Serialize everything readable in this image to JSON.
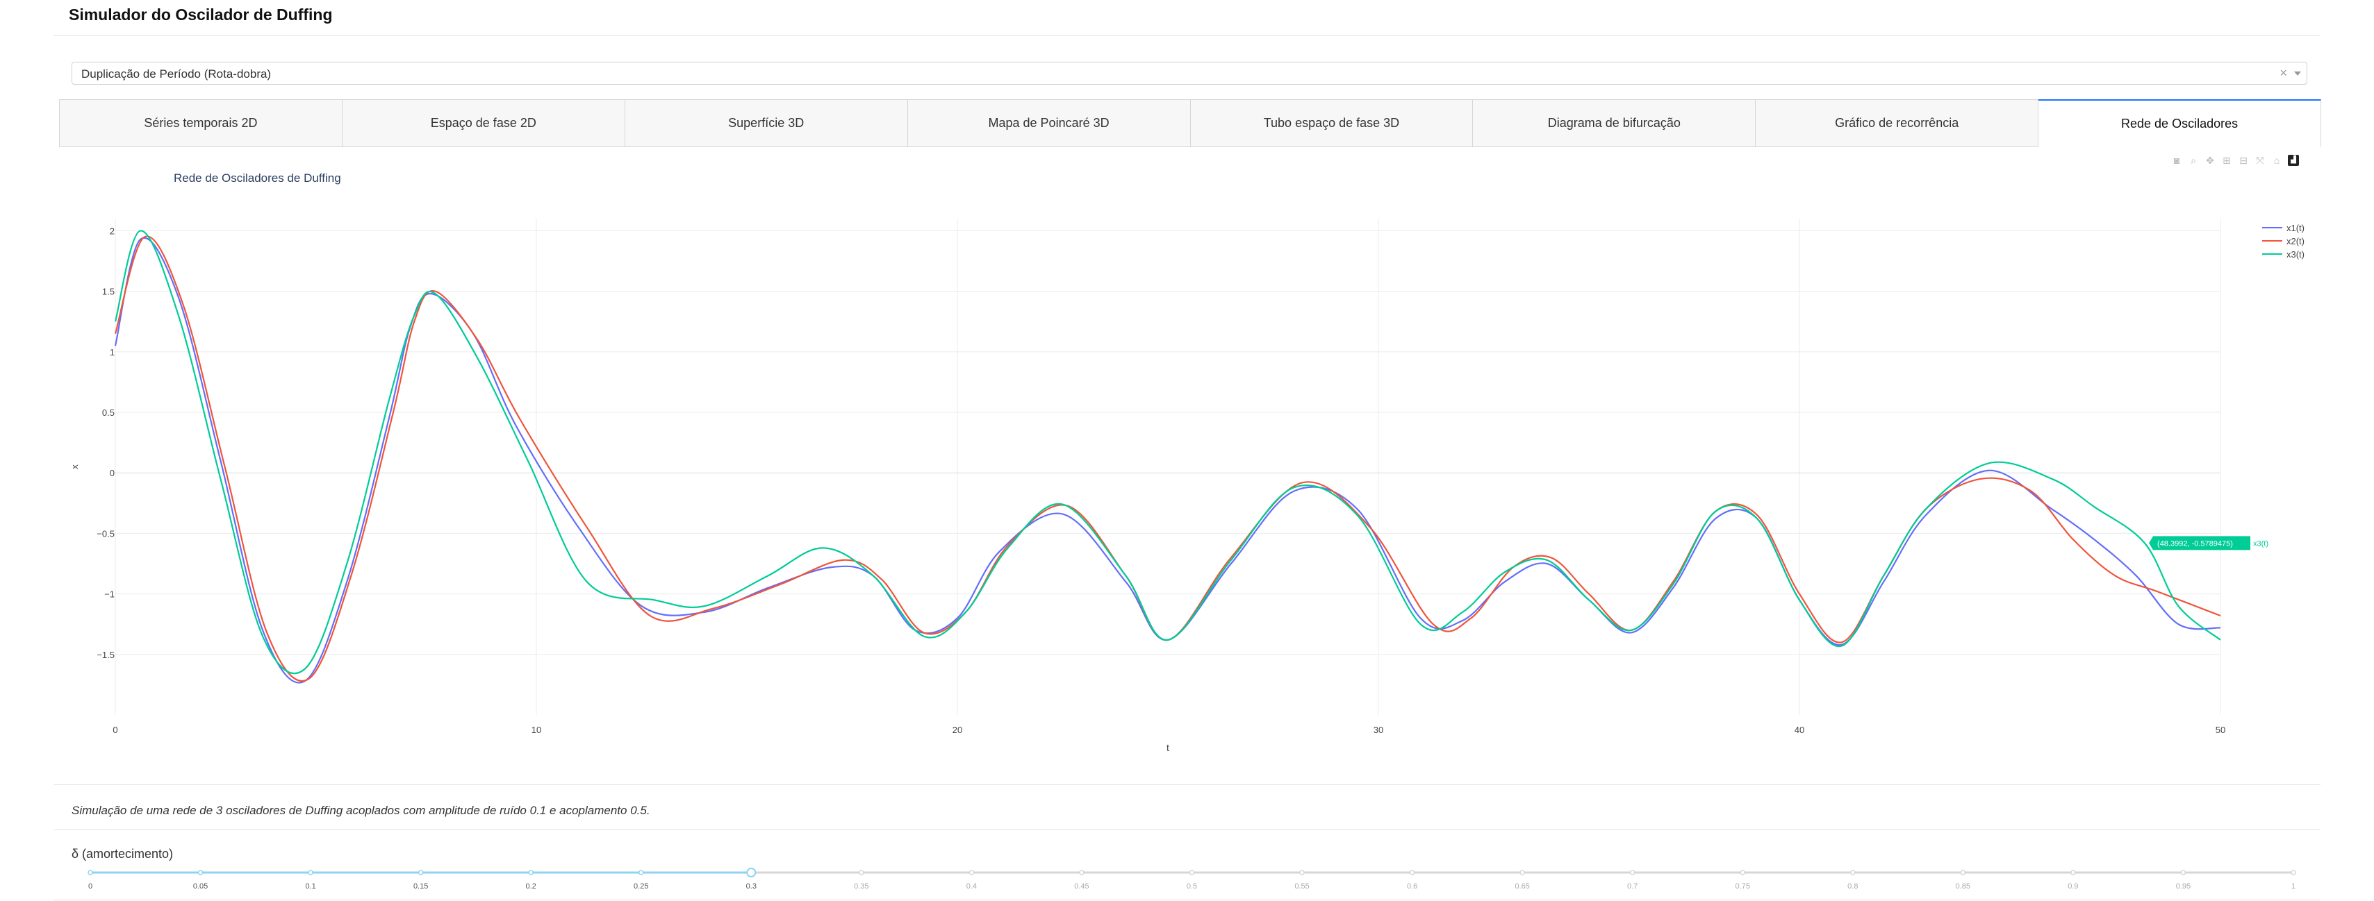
{
  "app": {
    "title": "Simulador do Oscilador de Duffing"
  },
  "preset": {
    "selected": "Duplicação de Período (Rota-dobra)",
    "clear": "×"
  },
  "tabs": [
    {
      "label": "Séries temporais 2D"
    },
    {
      "label": "Espaço de fase 2D"
    },
    {
      "label": "Superfície 3D"
    },
    {
      "label": "Mapa de Poincaré 3D"
    },
    {
      "label": "Tubo espaço de fase 3D"
    },
    {
      "label": "Diagrama de bifurcação"
    },
    {
      "label": "Gráfico de recorrência"
    },
    {
      "label": "Rede de Osciladores",
      "active": true
    }
  ],
  "modebar": [
    "camera-icon",
    "zoom-icon",
    "pan-icon",
    "zoom-in-icon",
    "zoom-out-icon",
    "autoscale-icon",
    "home-icon",
    "plotly-logo-icon"
  ],
  "chart_data": {
    "type": "line",
    "title": "Rede de Osciladores de Duffing",
    "xlabel": "t",
    "ylabel": "x",
    "xlim": [
      0,
      50
    ],
    "ylim": [
      -2,
      2.1
    ],
    "xticks": [
      0,
      10,
      20,
      30,
      40,
      50
    ],
    "yticks": [
      -1.5,
      -1,
      -0.5,
      0,
      0.5,
      1,
      1.5,
      2
    ],
    "ytick_labels": [
      "−1.5",
      "−1",
      "−0.5",
      "0",
      "0.5",
      "1",
      "1.5",
      "2"
    ],
    "grid": true,
    "legend_position": "top-right",
    "series": [
      {
        "name": "x1(t)",
        "color": "#636efa",
        "x": [
          0,
          0.6,
          1.5,
          2.5,
          3.5,
          4.5,
          5.5,
          6.5,
          7,
          7.5,
          8.5,
          9.5,
          11,
          12.5,
          14,
          15.5,
          17,
          18,
          19,
          20,
          21,
          22.5,
          24,
          25,
          26.5,
          28,
          29.5,
          31,
          32,
          33,
          34,
          35,
          36,
          37,
          38,
          39,
          40,
          41,
          42,
          43,
          44.5,
          46,
          47,
          48,
          49,
          50
        ],
        "y": [
          1.05,
          1.93,
          1.45,
          0.1,
          -1.3,
          -1.72,
          -0.9,
          0.45,
          1.2,
          1.48,
          1.15,
          0.4,
          -0.45,
          -1.1,
          -1.15,
          -0.95,
          -0.78,
          -0.85,
          -1.3,
          -1.2,
          -0.65,
          -0.34,
          -0.9,
          -1.38,
          -0.75,
          -0.15,
          -0.3,
          -1.2,
          -1.22,
          -0.9,
          -0.75,
          -1.05,
          -1.32,
          -0.95,
          -0.38,
          -0.38,
          -1.05,
          -1.42,
          -0.9,
          -0.35,
          0.02,
          -0.3,
          -0.55,
          -0.85,
          -1.25,
          -1.28
        ]
      },
      {
        "name": "x2(t)",
        "color": "#ef553b",
        "x": [
          0,
          0.7,
          1.6,
          2.6,
          3.6,
          4.6,
          5.6,
          6.6,
          7.1,
          7.6,
          8.6,
          9.6,
          11.2,
          12.7,
          14.2,
          15.8,
          17.3,
          18.2,
          19.2,
          20.2,
          21.2,
          22.6,
          24,
          25,
          26.5,
          28.2,
          29.8,
          31.3,
          32.2,
          33.2,
          34.1,
          35,
          36,
          37,
          38,
          39,
          40,
          41,
          42,
          43,
          44.3,
          45.5,
          46.5,
          47.5,
          48.5,
          50
        ],
        "y": [
          1.15,
          1.95,
          1.4,
          0.05,
          -1.32,
          -1.7,
          -0.85,
          0.5,
          1.25,
          1.5,
          1.1,
          0.45,
          -0.45,
          -1.18,
          -1.12,
          -0.92,
          -0.72,
          -0.88,
          -1.32,
          -1.15,
          -0.6,
          -0.27,
          -0.85,
          -1.38,
          -0.7,
          -0.08,
          -0.45,
          -1.25,
          -1.2,
          -0.78,
          -0.7,
          -1.0,
          -1.3,
          -0.9,
          -0.32,
          -0.35,
          -1.0,
          -1.4,
          -0.85,
          -0.3,
          -0.05,
          -0.15,
          -0.55,
          -0.85,
          -0.98,
          -1.18
        ]
      },
      {
        "name": "x3(t)",
        "color": "#00cc96",
        "x": [
          0,
          0.6,
          1.5,
          2.5,
          3.5,
          4.5,
          5.5,
          6.5,
          7.1,
          7.6,
          8.6,
          9.8,
          11.2,
          12.8,
          14,
          15.5,
          16.8,
          18,
          19.2,
          20.2,
          21.2,
          22.5,
          24,
          25,
          26.5,
          28,
          29.5,
          31,
          32,
          33,
          34,
          35,
          36,
          37,
          38,
          39,
          40,
          41,
          42,
          43,
          44.5,
          46,
          47,
          48.2,
          49,
          50
        ],
        "y": [
          1.25,
          2.0,
          1.3,
          -0.05,
          -1.35,
          -1.62,
          -0.75,
          0.6,
          1.3,
          1.48,
          0.95,
          0.1,
          -0.9,
          -1.05,
          -1.1,
          -0.85,
          -0.62,
          -0.85,
          -1.35,
          -1.15,
          -0.62,
          -0.26,
          -0.85,
          -1.38,
          -0.72,
          -0.12,
          -0.35,
          -1.25,
          -1.15,
          -0.82,
          -0.72,
          -1.05,
          -1.3,
          -0.92,
          -0.32,
          -0.38,
          -1.05,
          -1.43,
          -0.85,
          -0.3,
          0.08,
          -0.05,
          -0.28,
          -0.58,
          -1.1,
          -1.38
        ]
      }
    ],
    "hover": {
      "label": "(48.3992, -0.5789475)",
      "series": "x3(t)"
    }
  },
  "caption": "Simulação de uma rede de 3 osciladores de Duffing acoplados com amplitude de ruído 0.1 e acoplamento 0.5.",
  "slider": {
    "label": "δ (amortecimento)",
    "value": 0.3,
    "min": 0,
    "max": 1,
    "ticks": [
      "0",
      "0.05",
      "0.1",
      "0.15",
      "0.2",
      "0.25",
      "0.3",
      "0.35",
      "0.4",
      "0.45",
      "0.5",
      "0.55",
      "0.6",
      "0.65",
      "0.7",
      "0.75",
      "0.8",
      "0.85",
      "0.9",
      "0.95",
      "1"
    ]
  }
}
